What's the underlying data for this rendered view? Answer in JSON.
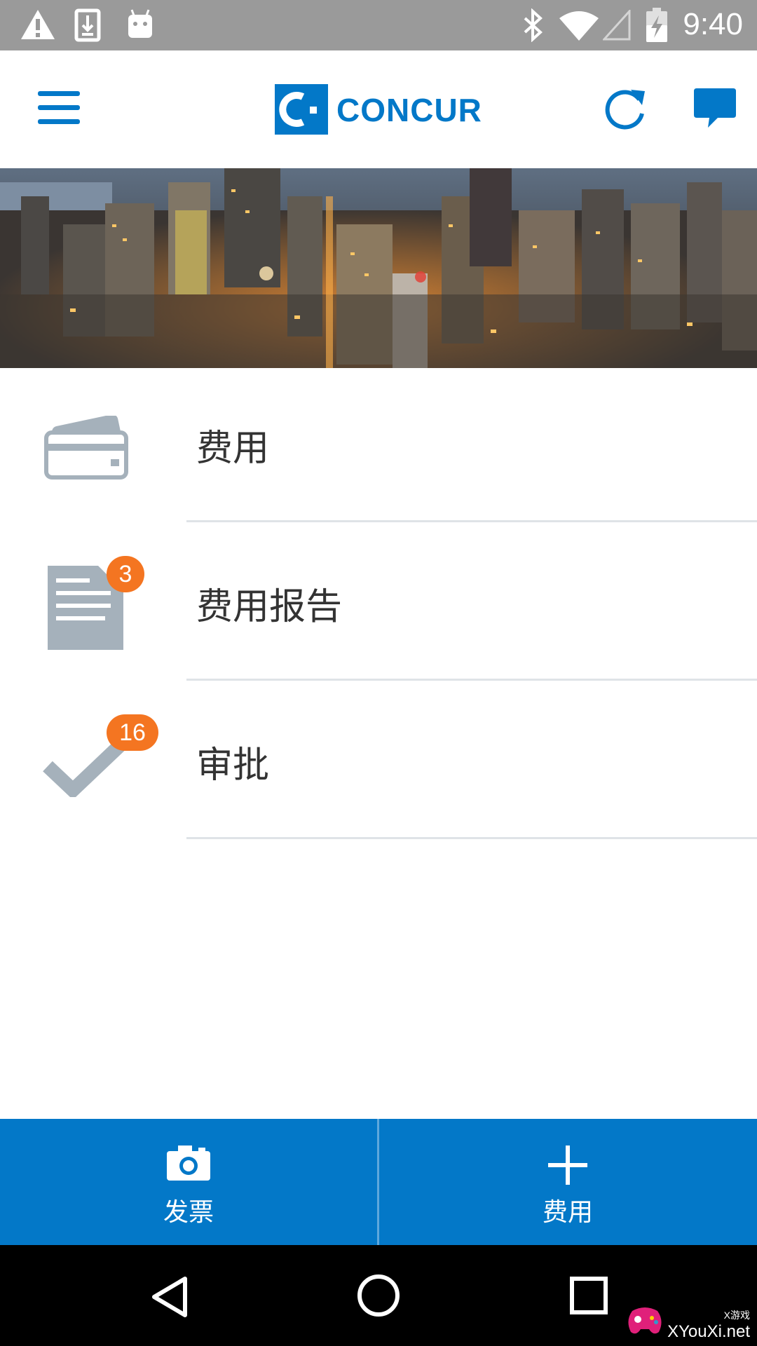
{
  "status_bar": {
    "time": "9:40",
    "icons": [
      "warning-icon",
      "download-icon",
      "android-icon",
      "bluetooth-icon",
      "wifi-icon",
      "cell-signal-icon",
      "battery-icon"
    ]
  },
  "app_bar": {
    "logo_text": "CONCUR",
    "menu_icon": "hamburger-icon",
    "refresh_icon": "refresh-icon",
    "messages_icon": "chat-icon"
  },
  "list": [
    {
      "label": "费用",
      "icon": "credit-card-icon",
      "badge": ""
    },
    {
      "label": "费用报告",
      "icon": "report-document-icon",
      "badge": "3"
    },
    {
      "label": "审批",
      "icon": "checkmark-icon",
      "badge": "16"
    }
  ],
  "bottom_actions": [
    {
      "label": "发票",
      "icon": "camera-icon"
    },
    {
      "label": "费用",
      "icon": "plus-icon"
    }
  ],
  "nav_bar": {
    "back_icon": "back-triangle-icon",
    "home_icon": "home-circle-icon",
    "recents_icon": "recents-square-icon"
  },
  "watermark": {
    "text": "XYouXi.net",
    "small": "X游戏"
  },
  "colors": {
    "brand_blue": "#0378c8",
    "badge_orange": "#f47521",
    "icon_gray": "#a5b1bb",
    "status_bar": "#9a9a9a"
  }
}
